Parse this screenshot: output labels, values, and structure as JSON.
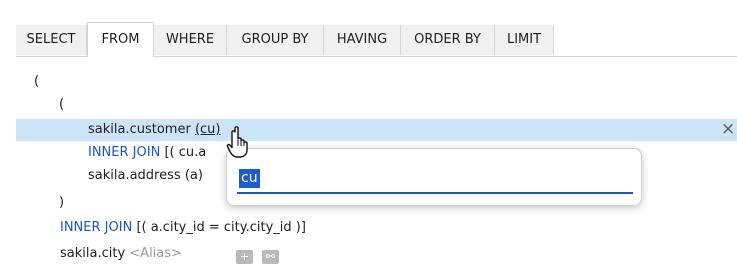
{
  "tabs": [
    {
      "label": "SELECT",
      "active": false
    },
    {
      "label": "FROM",
      "active": true
    },
    {
      "label": "WHERE",
      "active": false
    },
    {
      "label": "GROUP BY",
      "active": false
    },
    {
      "label": "HAVING",
      "active": false
    },
    {
      "label": "ORDER BY",
      "active": false
    },
    {
      "label": "LIMIT",
      "active": false
    }
  ],
  "editor": {
    "open_paren_outer": "(",
    "open_paren_inner": "(",
    "row1_table": "sakila.customer",
    "row1_alias": "(cu)",
    "row2_join_keyword": "INNER JOIN",
    "row2_condition": "[( cu.a",
    "row3_table": "sakila.address",
    "row3_alias": "(a)",
    "close_paren_inner": ")",
    "row5_join_keyword": "INNER JOIN",
    "row5_condition": "[( a.city_id = city.city_id )]",
    "row6_table": "sakila.city",
    "row6_alias_placeholder": "<Alias>",
    "row6_add_button": "+",
    "row6_link_button": "⚯"
  },
  "alias_popup": {
    "value": "cu"
  },
  "icons": {
    "close": "close-icon",
    "cursor": "hand-pointer-cursor-icon"
  },
  "colors": {
    "selection_row": "#cce4f7",
    "keyword": "#1a56c8",
    "input_focus": "#1a56c8",
    "text_selection": "#1a5fc9"
  }
}
